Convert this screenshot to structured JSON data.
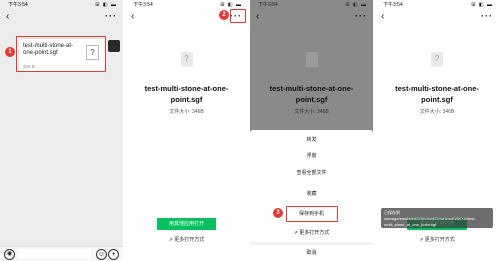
{
  "status": {
    "time": "下午3:54",
    "signal": "⊞ ◧ ▬"
  },
  "panel1": {
    "file_name": "test-multi-stone-at-one-point.sgf",
    "file_size": "346 B",
    "step": "1"
  },
  "panel2": {
    "file_name": "test-multi-stone-at-one-point.sgf",
    "file_size": "文件大小: 346B",
    "open_other_app": "用其他应用打开",
    "more_open": "⇗ 更多打开方式",
    "step": "2"
  },
  "panel3": {
    "file_name": "test-multi-stone-at-one-point.sgf",
    "file_size": "文件大小: 346B",
    "step": "3",
    "menu": [
      "转发",
      "浮窗",
      "查看全部文件",
      "收藏",
      "保存到手机",
      "⇗ 更多打开方式",
      "取消"
    ]
  },
  "panel4": {
    "file_name": "test-multi-stone-at-one-point.sgf",
    "file_size": "文件大小: 346B",
    "toast": "已保存到 /storage/emulated/0/Android/Download/WeiXin/test-multi_stone_at_one_point.sgf",
    "open_other_app": "用其他应用打开",
    "more_open": "⇗ 更多打开方式"
  },
  "colors": {
    "accent": "#07c160",
    "highlight": "#e53935"
  }
}
